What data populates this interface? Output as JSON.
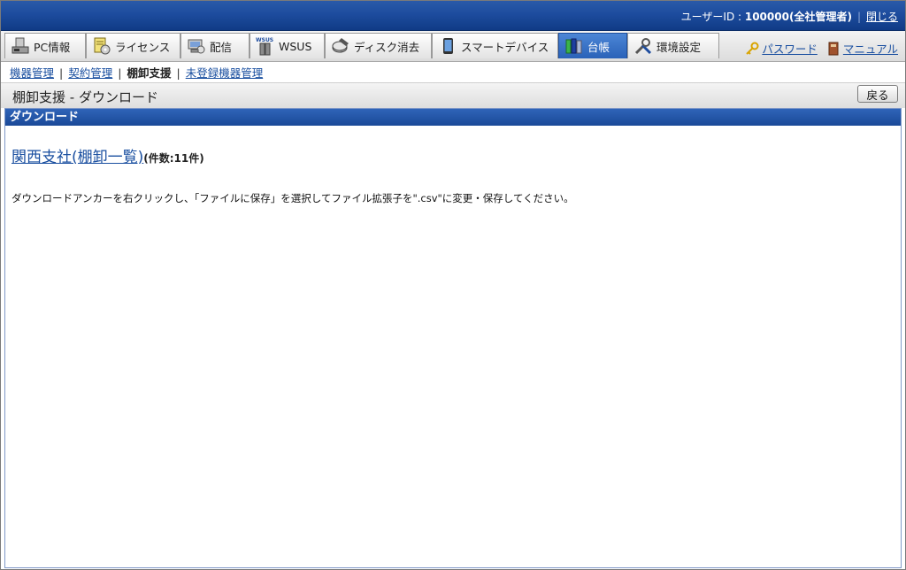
{
  "header": {
    "user_label": "ユーザーID : ",
    "user_value": "100000(全社管理者)",
    "logout": "閉じる"
  },
  "tabs": [
    {
      "label": "PC情報",
      "icon": "pc-icon"
    },
    {
      "label": "ライセンス",
      "icon": "license-icon"
    },
    {
      "label": "配信",
      "icon": "delivery-icon"
    },
    {
      "label": "WSUS",
      "icon": "wsus-icon"
    },
    {
      "label": "ディスク消去",
      "icon": "disk-erase-icon"
    },
    {
      "label": "スマートデバイス",
      "icon": "smart-device-icon"
    },
    {
      "label": "台帳",
      "icon": "ledger-icon"
    },
    {
      "label": "環境設定",
      "icon": "settings-icon"
    }
  ],
  "tools": {
    "password": "パスワード",
    "manual": "マニュアル"
  },
  "subnav": {
    "items": [
      "機器管理",
      "契約管理",
      "棚卸支援",
      "未登録機器管理"
    ]
  },
  "page": {
    "title": "棚卸支援 - ダウンロード",
    "back": "戻る"
  },
  "section": {
    "title": "ダウンロード",
    "link": "関西支社(棚卸一覧)",
    "count": "(件数:11件)",
    "note": "ダウンロードアンカーを右クリックし、「ファイルに保存」を選択してファイル拡張子を\".csv\"に変更・保存してください。"
  },
  "colors": {
    "accent": "#1d4c9e",
    "link": "#1a4fa0"
  }
}
